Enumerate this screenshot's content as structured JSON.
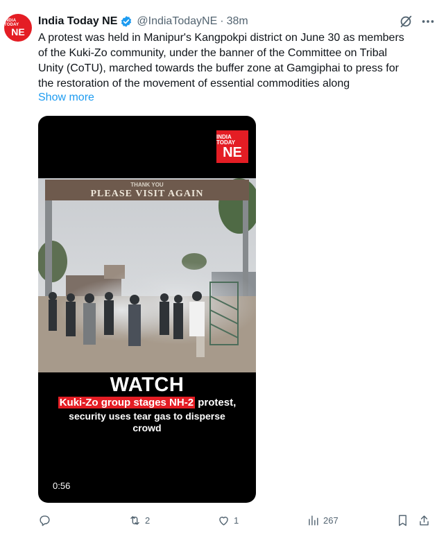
{
  "avatar": {
    "line1": "INDIA TODAY",
    "line2": "NE"
  },
  "header": {
    "name": "India Today NE",
    "handle": "@IndiaTodayNE",
    "separator": "·",
    "time": "38m"
  },
  "tweet": {
    "lines": [
      "A protest was held in Manipur's Kangpokpi district on June 30 as members",
      "of the Kuki-Zo community, under the banner of the Committee on Tribal",
      "Unity (CoTU), marched towards the buffer zone at Gamgiphai to press for",
      "the restoration of the movement of essential commodities along"
    ],
    "show_more": "Show more"
  },
  "video": {
    "logo_small": "INDIA TODAY",
    "logo_big": "NE",
    "gate_sign_top": "THANK YOU",
    "gate_sign": "PLEASE VISIT AGAIN",
    "watch": "WATCH",
    "caption_highlight": "Kuki-Zo group stages NH-2",
    "caption_rest": "protest,",
    "caption_line2": "security uses tear gas to disperse",
    "caption_line3": "crowd",
    "duration": "0:56"
  },
  "actions": {
    "replies": "",
    "reposts": "2",
    "likes": "1",
    "views": "267"
  },
  "colors": {
    "brand": "#e41d24",
    "link": "#1d9bf0",
    "muted": "#536471"
  },
  "icons": [
    "verified-badge-icon",
    "grok-icon",
    "more-icon",
    "reply-icon",
    "repost-icon",
    "like-icon",
    "views-icon",
    "bookmark-icon",
    "share-icon"
  ]
}
